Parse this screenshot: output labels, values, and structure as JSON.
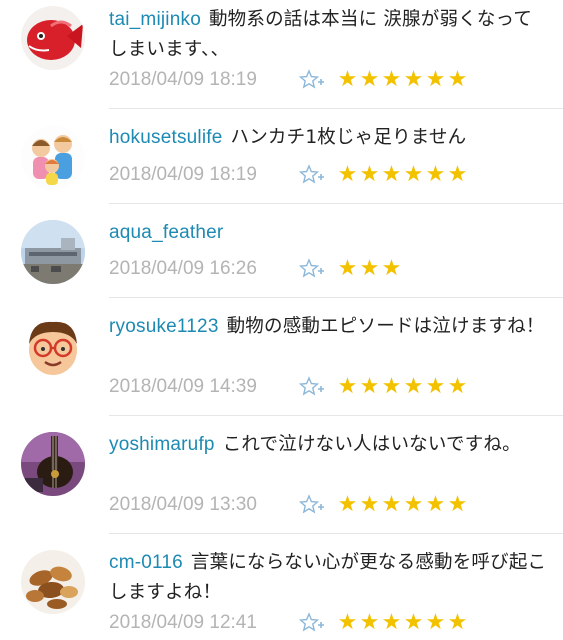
{
  "colors": {
    "username": "#1d8ab3",
    "timestamp": "#b4b4b4",
    "star": "#f2c200",
    "fav_icon": "#8cb7d9",
    "divider": "#e6e6e6"
  },
  "star_glyph": "★",
  "comments": [
    {
      "username": "tai_mijinko",
      "message": "動物系の話は本当に 涙腺が弱くなってしまいます、、",
      "timestamp": "2018/04/09 18:19",
      "rating": 6,
      "avatar_icon": "red-fish-avatar-icon"
    },
    {
      "username": "hokusetsulife",
      "message": "ハンカチ1枚じゃ足りません",
      "timestamp": "2018/04/09 18:19",
      "rating": 6,
      "avatar_icon": "family-illustration-avatar-icon"
    },
    {
      "username": "aqua_feather",
      "message": "",
      "timestamp": "2018/04/09 16:26",
      "rating": 3,
      "avatar_icon": "building-photo-avatar-icon"
    },
    {
      "username": "ryosuke1123",
      "message": "動物の感動エピソードは泣けますね！",
      "timestamp": "2018/04/09 14:39",
      "rating": 6,
      "avatar_icon": "glasses-face-avatar-icon"
    },
    {
      "username": "yoshimarufp",
      "message": "これで泣けない人はいないですね。",
      "timestamp": "2018/04/09 13:30",
      "rating": 6,
      "avatar_icon": "guitar-photo-avatar-icon"
    },
    {
      "username": "cm-0116",
      "message": "言葉にならない心が更なる感動を呼び起こしますよね！",
      "timestamp": "2018/04/09 12:41",
      "rating": 6,
      "avatar_icon": "nuts-photo-avatar-icon"
    }
  ]
}
